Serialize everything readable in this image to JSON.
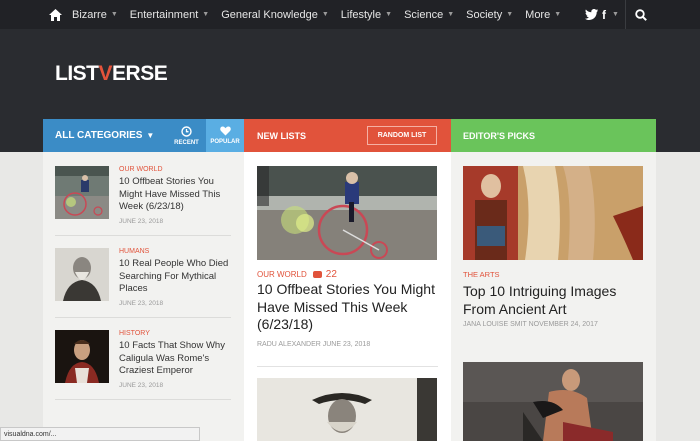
{
  "nav": {
    "items": [
      {
        "label": "Bizarre"
      },
      {
        "label": "Entertainment"
      },
      {
        "label": "General Knowledge"
      },
      {
        "label": "Lifestyle"
      },
      {
        "label": "Science"
      },
      {
        "label": "Society"
      },
      {
        "label": "More"
      }
    ],
    "social_twitter": "🐦",
    "social_facebook": "f"
  },
  "logo": {
    "pre": "LIST",
    "v": "V",
    "post": "ERSE"
  },
  "columns": {
    "categories": {
      "label": "ALL CATEGORIES",
      "recent": "RECENT",
      "popular": "POPULAR"
    },
    "new_lists": {
      "label": "NEW LISTS",
      "random": "RANDOM LIST"
    },
    "editors": {
      "label": "EDITOR'S PICKS"
    }
  },
  "left_items": [
    {
      "category": "OUR WORLD",
      "title": "10 Offbeat Stories You Might Have Missed This Week (6/23/18)",
      "date": "JUNE 23, 2018"
    },
    {
      "category": "HUMANS",
      "title": "10 Real People Who Died Searching For Mythical Places",
      "date": "JUNE 23, 2018"
    },
    {
      "category": "HISTORY",
      "title": "10 Facts That Show Why Caligula Was Rome's Craziest Emperor",
      "date": "JUNE 23, 2018"
    }
  ],
  "middle": {
    "category": "OUR WORLD",
    "comments": "22",
    "title": "10 Offbeat Stories You Might Have Missed This Week (6/23/18)",
    "author": "RADU ALEXANDER JUNE 23, 2018"
  },
  "right": {
    "category": "THE ARTS",
    "title": "Top 10 Intriguing Images From Ancient Art",
    "author": "JANA LOUISE SMIT NOVEMBER 24, 2017"
  },
  "status": {
    "url": "visualdna.com/..."
  },
  "colors": {
    "blue": "#3b8cc6",
    "red": "#e1533b",
    "green": "#6ac45b",
    "dark": "#2a2c30"
  }
}
